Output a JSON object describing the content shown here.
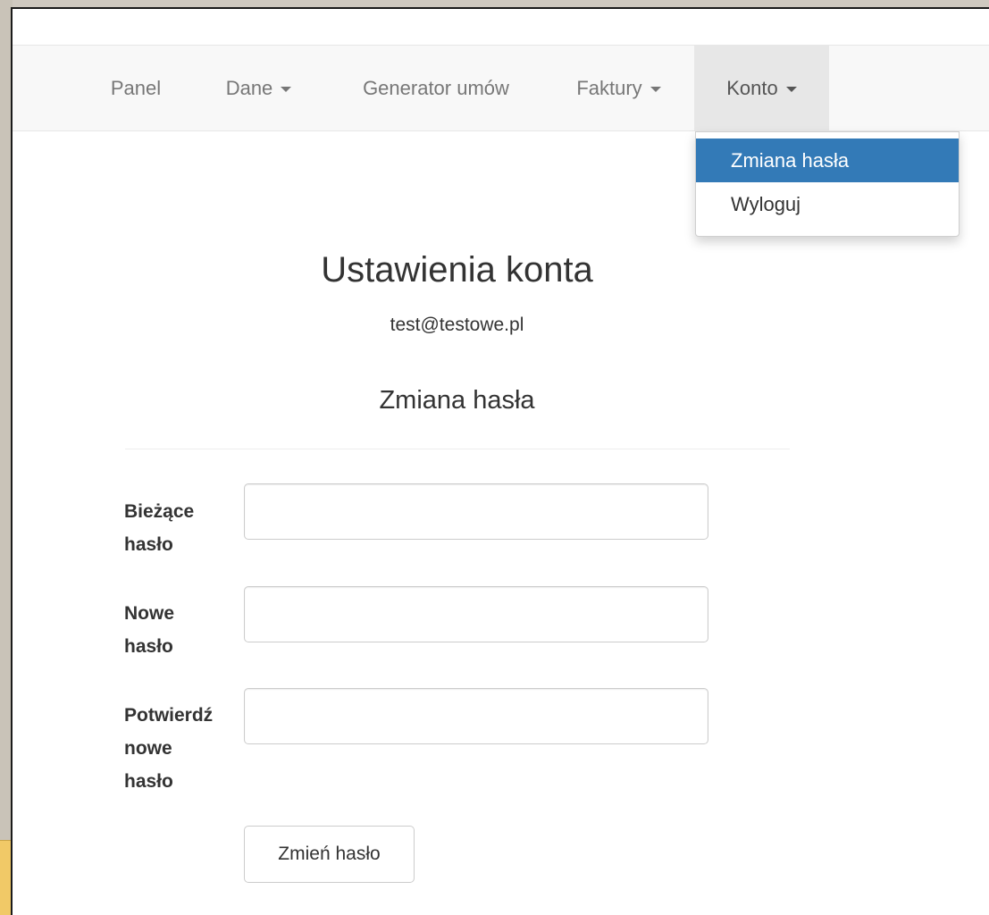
{
  "navbar": {
    "items": [
      {
        "label": "Panel",
        "has_caret": false
      },
      {
        "label": "Dane",
        "has_caret": true
      },
      {
        "label": "Generator umów",
        "has_caret": false
      },
      {
        "label": "Faktury",
        "has_caret": true
      },
      {
        "label": "Konto",
        "has_caret": true,
        "active": true
      }
    ]
  },
  "dropdown": {
    "items": [
      {
        "label": "Zmiana hasła",
        "active": true
      },
      {
        "label": "Wyloguj",
        "active": false
      }
    ]
  },
  "page": {
    "title": "Ustawienia konta",
    "email": "test@testowe.pl",
    "section_title": "Zmiana hasła"
  },
  "form": {
    "current_password": {
      "label_line1": "Bieżące",
      "label_line2": "hasło",
      "value": ""
    },
    "new_password": {
      "label_line1": "Nowe",
      "label_line2": "hasło",
      "value": ""
    },
    "confirm_password": {
      "label_line1": "Potwierdź",
      "label_line2": "nowe",
      "label_line3": "hasło",
      "value": ""
    },
    "submit_label": "Zmień hasło"
  },
  "colors": {
    "active_dropdown_bg": "#337ab7",
    "navbar_bg": "#f8f8f8",
    "nav_active_bg": "#e7e7e7"
  }
}
